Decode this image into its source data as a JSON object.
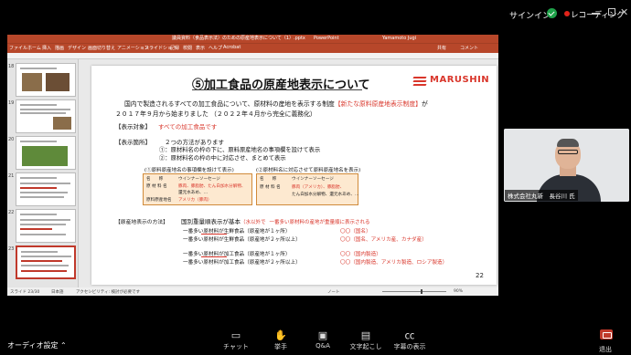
{
  "topbar": {
    "signin": "サインイン",
    "recording": "レコーディング"
  },
  "ppt": {
    "title_doc": "議員資料（食品表示法）のための原産地表示について（1）.pptx",
    "title_app": "PowerPoint",
    "user": "Yamamoto Jugi",
    "ribbon_tabs": [
      "ファイル",
      "ホーム",
      "挿入",
      "描画",
      "デザイン",
      "画面切り替え",
      "アニメーション",
      "スライドショー",
      "記録",
      "校閲",
      "表示",
      "ヘルプ",
      "Acrobat",
      "共有",
      "コメント"
    ],
    "status_left": "スライド 23/30",
    "status_lang": "日本語",
    "status_access": "アクセシビリティ: 検討が必要です",
    "status_notes": "ノート",
    "status_zoom": "90%",
    "thumb_numbers": [
      "18",
      "19",
      "20",
      "21",
      "22",
      "23"
    ]
  },
  "slide": {
    "title": "⑤加工食品の原産地表示について",
    "logo": "MARUSHIN",
    "intro_1a": "国内で製造されるすべての加工食品について、原材料の産地を表示する制度",
    "intro_1b": "【新たな原料原産地表示制度】",
    "intro_1c": "が",
    "intro_2": "２０１７年９月から始まりました （２０２２年４月から完全に義務化）",
    "target_label": "【表示対象】",
    "target_value": "すべての加工食品です",
    "place_label": "【表示箇所】",
    "place_1": "２つの方法があります",
    "place_2": "①：原材料名の枠の下に、原料原産地名の事項欄を設けて表示",
    "place_3": "②：原材料名の枠の中に対応させ、まとめて表示",
    "tbl_left_cap": "(①原料原産地名の事項欄を設けて表示)",
    "tbl_right_cap": "(②原材料名に対応させて原料原産地名を表示)",
    "tbl_left": {
      "r1k": "名　　称",
      "r1v": "ウインナーソーセージ",
      "r2k": "原 材 料 名",
      "r2v": "豚肉、豚脂肪、たん白加水分解物、",
      "r2v2": "還元水あめ、…",
      "r3k": "原料原産地名",
      "r3v": "アメリカ（豚肉）"
    },
    "tbl_right": {
      "r1k": "名　　称",
      "r1v": "ウインナーソーセージ",
      "r2k": "原 材 料 名",
      "r2v": "豚肉（アメリカ）、豚脂肪、",
      "r2v2": "たん白加水分解物、還元水あめ、…"
    },
    "method_label": "【原産地表示の方法】",
    "method_1": "国別重量順表示が基本",
    "method_1b": "（水以外で",
    "method_1c": "一番多い原材料の産地が重量順に表示される",
    "rows": [
      {
        "left": "一番多い原材料が生鮮食品（原産地が１ヶ所）",
        "right": "〇〇（国名）"
      },
      {
        "left": "一番多い原材料が生鮮食品（原産地が２ヶ所以上）",
        "right": "〇〇（国名、アメリカ産、カナダ産）"
      },
      {
        "left": "一番多い原材料が加工食品（原産地が１ヶ所）",
        "right": "〇〇（国内製造）"
      },
      {
        "left": "一番多い原材料が加工食品（原産地が２ヶ所以上）",
        "right": "〇〇（国内製造、アメリカ製造、ロシア製造）"
      }
    ],
    "page": "22"
  },
  "camera": {
    "label": "株式会社丸新　長谷川 氏"
  },
  "bottom": {
    "audio": "オーディオ設定",
    "controls": [
      {
        "icon": "chat-icon",
        "label": "チャット"
      },
      {
        "icon": "raise-hand-icon",
        "label": "挙手"
      },
      {
        "icon": "qa-icon",
        "label": "Q&A"
      },
      {
        "icon": "transcript-icon",
        "label": "文字起こし"
      },
      {
        "icon": "captions-icon",
        "label": "字幕の表示"
      }
    ],
    "leave": "退出"
  }
}
